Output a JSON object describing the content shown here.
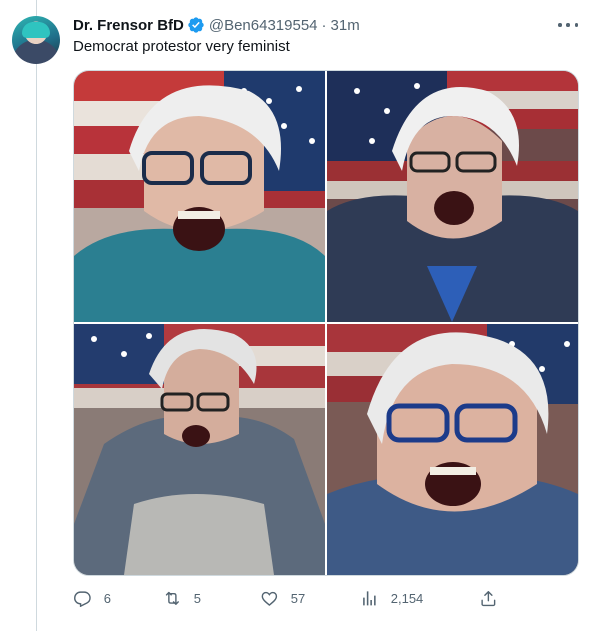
{
  "tweet": {
    "display_name": "Dr. Frensor BfD",
    "handle": "@Ben64319554",
    "separator": "·",
    "time": "31m",
    "text": "Democrat protestor very feminist",
    "verified": true,
    "verified_color": "#1d9bf0"
  },
  "media": [
    {
      "icon": "photo-protestor-1"
    },
    {
      "icon": "photo-protestor-2"
    },
    {
      "icon": "photo-protestor-3"
    },
    {
      "icon": "photo-protestor-4"
    }
  ],
  "actions": {
    "reply_count": "6",
    "retweet_count": "5",
    "like_count": "57",
    "views_count": "2,154"
  },
  "colors": {
    "text": "#0f1419",
    "muted": "#536471",
    "border": "#cfd9de"
  }
}
